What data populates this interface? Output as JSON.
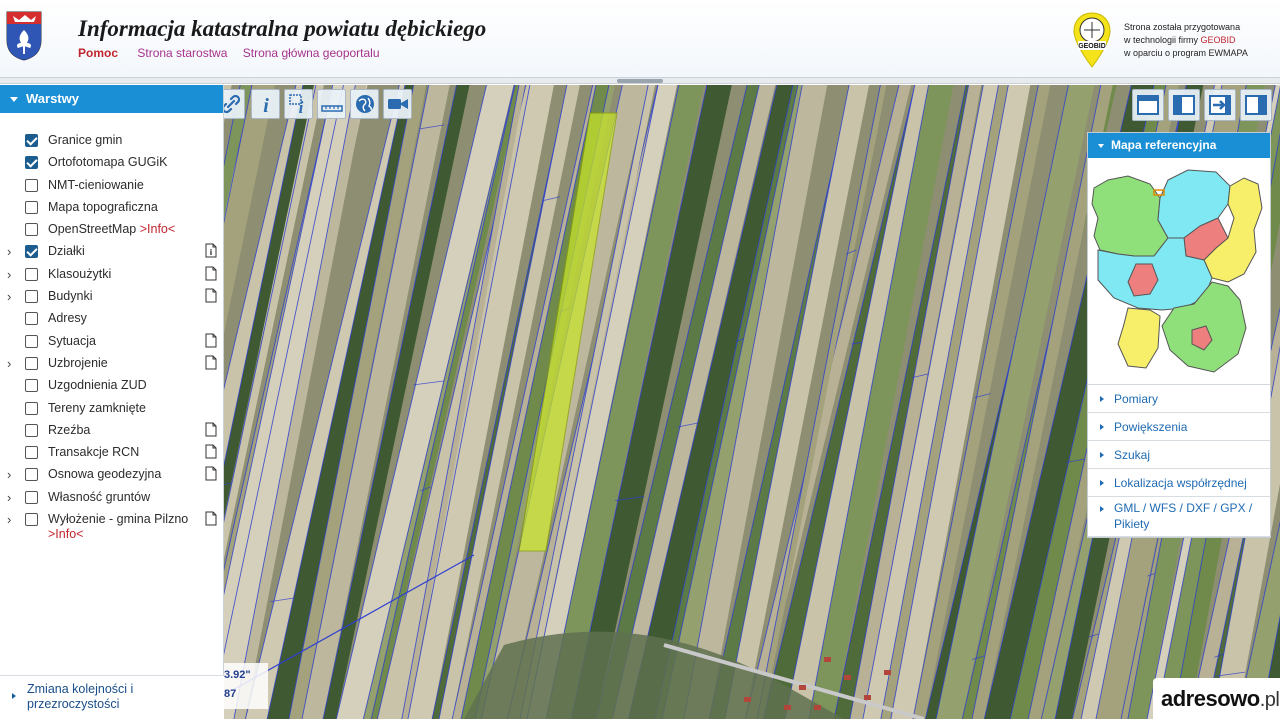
{
  "header": {
    "title": "Informacja katastralna powiatu dębickiego",
    "nav": {
      "help": "Pomoc",
      "county_site": "Strona starostwa",
      "geoportal_home": "Strona główna geoportalu"
    },
    "geobid": {
      "logo_text": "GEOBID",
      "line1": "Strona została przygotowana",
      "line2_prefix": "w technologii firmy ",
      "line2_brand": "GEOBID",
      "line3": "w oparciu o program EWMAPA"
    }
  },
  "layers_panel": {
    "title": "Warstwy",
    "items": [
      {
        "label": "Granice gmin",
        "checked": true,
        "expandable": false,
        "doc": false
      },
      {
        "label": "Ortofotomapa GUGiK",
        "checked": true,
        "expandable": false,
        "doc": false
      },
      {
        "label": "NMT-cieniowanie",
        "checked": false,
        "expandable": false,
        "doc": false
      },
      {
        "label": "Mapa topograficzna",
        "checked": false,
        "expandable": false,
        "doc": false
      },
      {
        "label": "OpenStreetMap",
        "info": ">Info<",
        "checked": false,
        "expandable": false,
        "doc": false
      },
      {
        "label": "Działki",
        "checked": true,
        "expandable": true,
        "doc": true
      },
      {
        "label": "Klasoużytki",
        "checked": false,
        "expandable": true,
        "doc": true
      },
      {
        "label": "Budynki",
        "checked": false,
        "expandable": true,
        "doc": true
      },
      {
        "label": "Adresy",
        "checked": false,
        "expandable": false,
        "doc": false
      },
      {
        "label": "Sytuacja",
        "checked": false,
        "expandable": false,
        "doc": true
      },
      {
        "label": "Uzbrojenie",
        "checked": false,
        "expandable": true,
        "doc": true
      },
      {
        "label": "Uzgodnienia ZUD",
        "checked": false,
        "expandable": false,
        "doc": false
      },
      {
        "label": "Tereny zamknięte",
        "checked": false,
        "expandable": false,
        "doc": false
      },
      {
        "label": "Rzeźba",
        "checked": false,
        "expandable": false,
        "doc": true
      },
      {
        "label": "Transakcje RCN",
        "checked": false,
        "expandable": false,
        "doc": true
      },
      {
        "label": "Osnowa geodezyjna",
        "checked": false,
        "expandable": true,
        "doc": true
      },
      {
        "label": "Własność gruntów",
        "checked": false,
        "expandable": true,
        "doc": false
      },
      {
        "label": "Wyłożenie - gmina Pilzno",
        "info": ">Info<",
        "checked": false,
        "expandable": true,
        "doc": true
      }
    ],
    "order_link": "Zmiana kolejności i przezroczystości"
  },
  "map": {
    "toolbar_icons": [
      "link-icon",
      "info-icon",
      "info-box-icon",
      "measure-ruler-icon",
      "globe-icon",
      "video-camera-icon"
    ],
    "view_icons": [
      "layout-full-icon",
      "layout-left-panel-icon",
      "layout-export-icon",
      "layout-right-panel-icon"
    ],
    "coords": {
      "line1": "3.92\"",
      "line2": "87"
    }
  },
  "right_panel": {
    "title": "Mapa referencyjna",
    "items": [
      "Pomiary",
      "Powiększenia",
      "Szukaj",
      "Lokalizacja współrzędnej",
      "GML / WFS / DXF / GPX / Pikiety"
    ]
  },
  "watermark": {
    "name": "adresowo",
    "suffix": ".pl"
  },
  "colors": {
    "accent": "#1a8fd6",
    "parcel_lines": "#2d3fd0",
    "highlight_parcel": "#c8e62a",
    "help_link": "#c0262f",
    "nav_link": "#a6328c"
  }
}
